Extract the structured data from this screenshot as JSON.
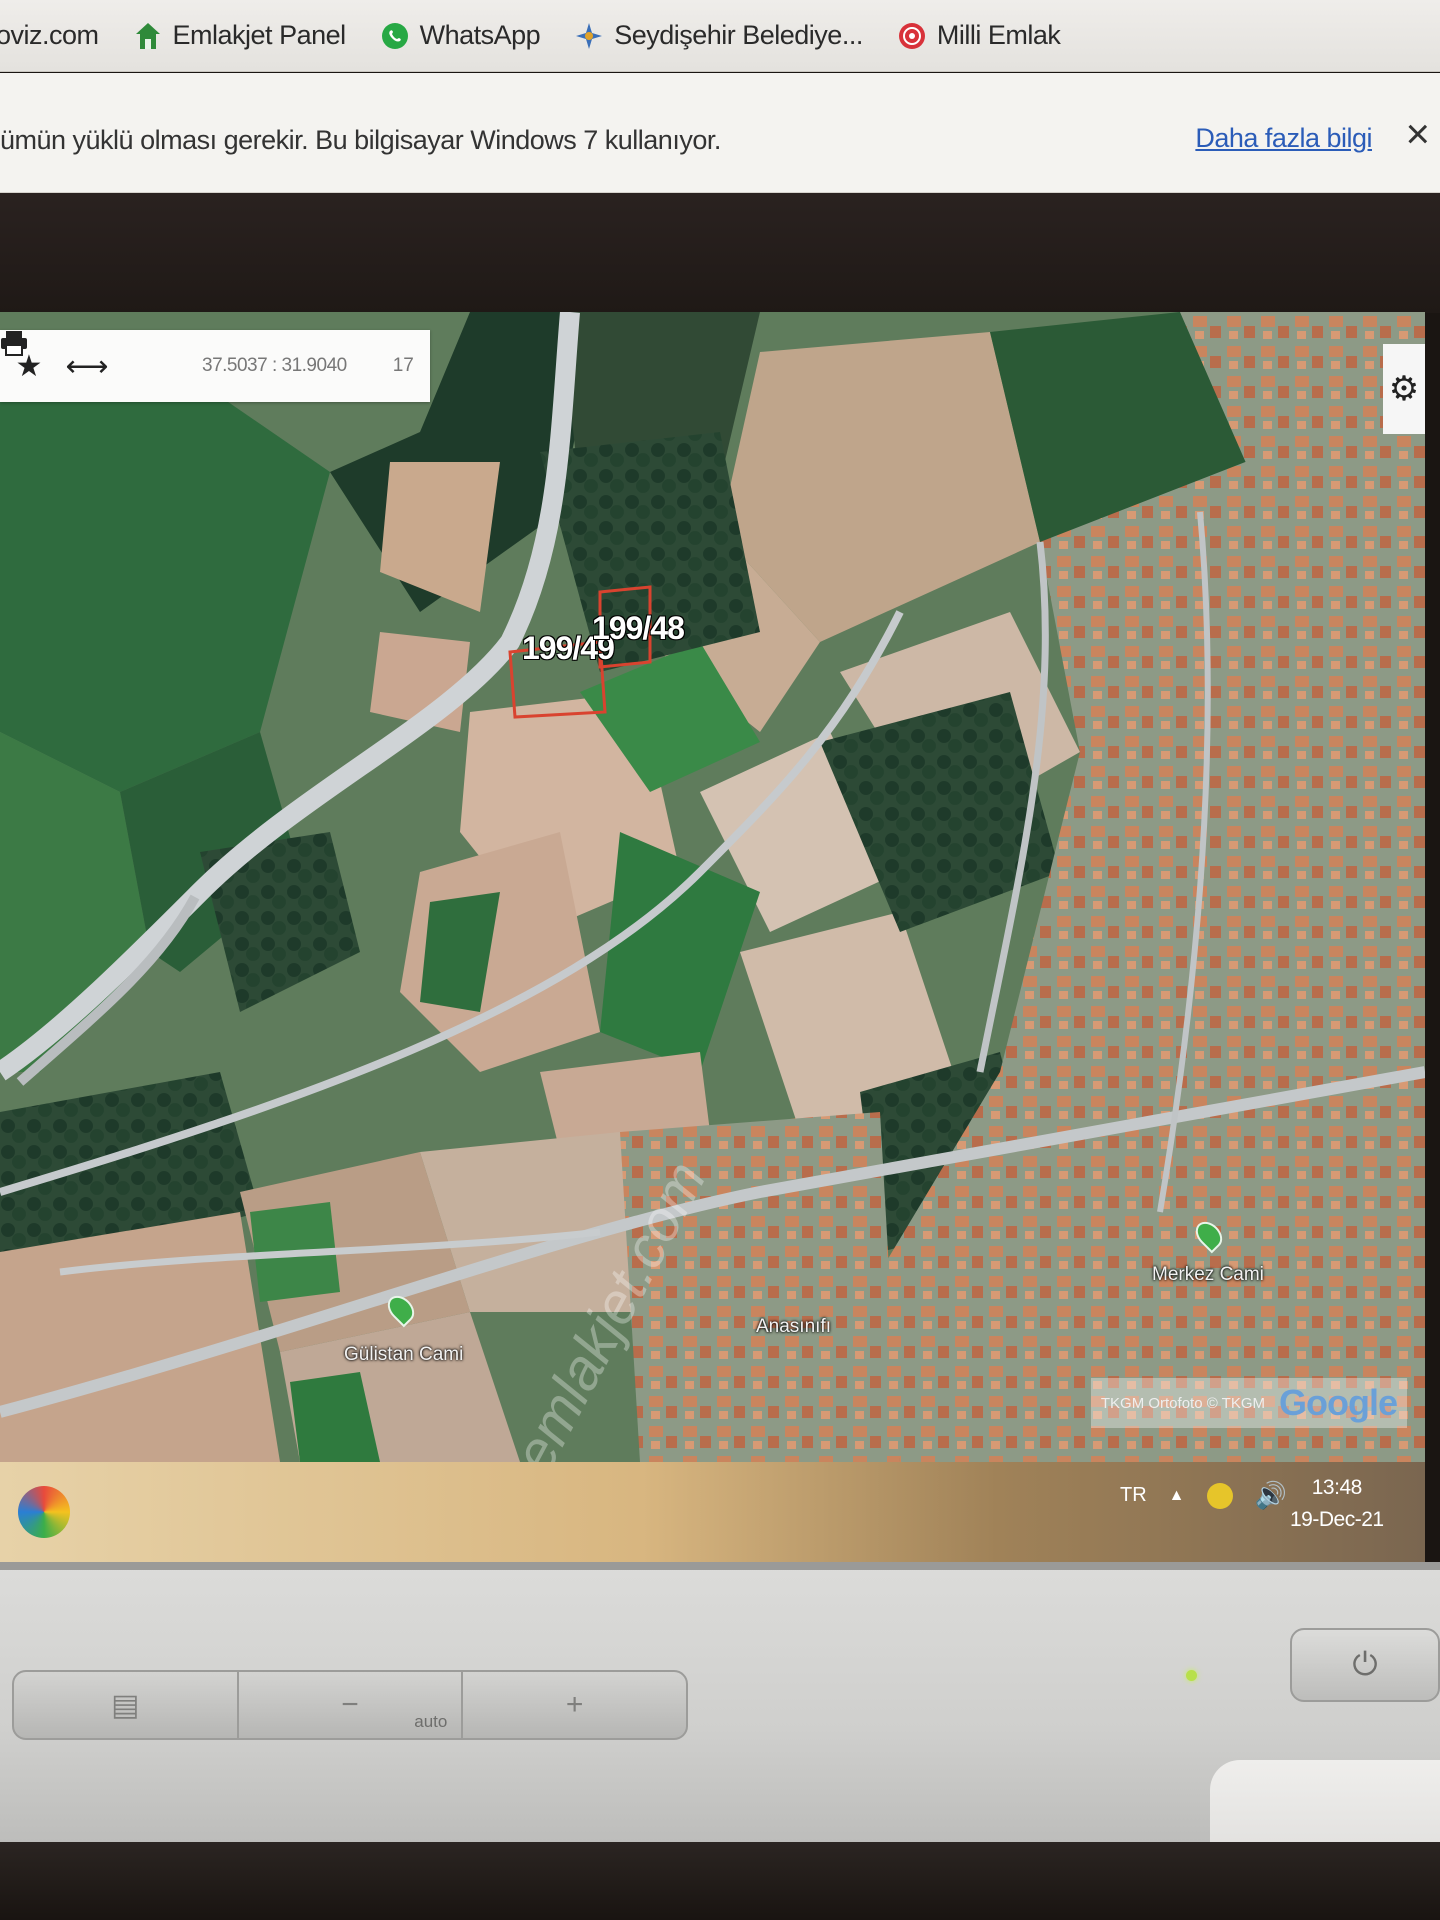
{
  "bookmarks": [
    {
      "label": "oviz.com",
      "icon": "site-icon"
    },
    {
      "label": "Emlakjet Panel",
      "icon": "house-icon"
    },
    {
      "label": "WhatsApp",
      "icon": "whatsapp-icon"
    },
    {
      "label": "Seydişehir Belediye...",
      "icon": "municipality-icon"
    },
    {
      "label": "Milli Emlak",
      "icon": "seal-icon"
    }
  ],
  "infobar": {
    "message": "ümün yüklü olması gerekir. Bu bilgisayar Windows 7 kullanıyor.",
    "link": "Daha fazla bilgi",
    "close": "×"
  },
  "map": {
    "toolbar": {
      "star": "★",
      "measure": "⟷",
      "print": "🖶",
      "coordinates": "37.5037 : 31.9040",
      "zoom_level": "17"
    },
    "settings_icon": "⚙",
    "parcels": [
      {
        "label": "199/49"
      },
      {
        "label": "199/48"
      }
    ],
    "pois": [
      {
        "label": "Gülistan Cami"
      },
      {
        "label": "Merkez Cami"
      },
      {
        "label": "Anasınıfı"
      }
    ],
    "attribution": "TKGM Ortofoto © TKGM",
    "google": "Google",
    "watermark": "emlakjet.com"
  },
  "taskbar": {
    "lang": "TR",
    "tray_arrow": "▲",
    "volume": "🔊",
    "time": "13:48",
    "date": "19-Dec-21"
  },
  "monitor": {
    "menu_symbol": "▤",
    "minus": "−",
    "auto": "auto",
    "plus": "+",
    "power": "⏻"
  }
}
